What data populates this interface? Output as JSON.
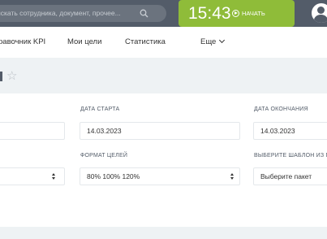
{
  "header": {
    "search_placeholder": "искать сотрудника, документ, прочее...",
    "clock_time": "15:43",
    "start_button": "НАЧАТЬ"
  },
  "nav": {
    "items": [
      "равочник KPI",
      "Мои цели",
      "Статистика",
      "Еще"
    ]
  },
  "form": {
    "start_date_label": "ДАТА СТАРТА",
    "start_date_value": "14.03.2023",
    "end_date_label": "ДАТА ОКОНЧАНИЯ",
    "end_date_value": "14.03.2023",
    "goal_format_label": "ФОРМАТ ЦЕЛЕЙ",
    "goal_format_value": "80% 100% 120%",
    "template_label": "ВЫБЕРИТЕ ШАБЛОН ИЗ ПР",
    "template_value": "Выберите пакет"
  }
}
